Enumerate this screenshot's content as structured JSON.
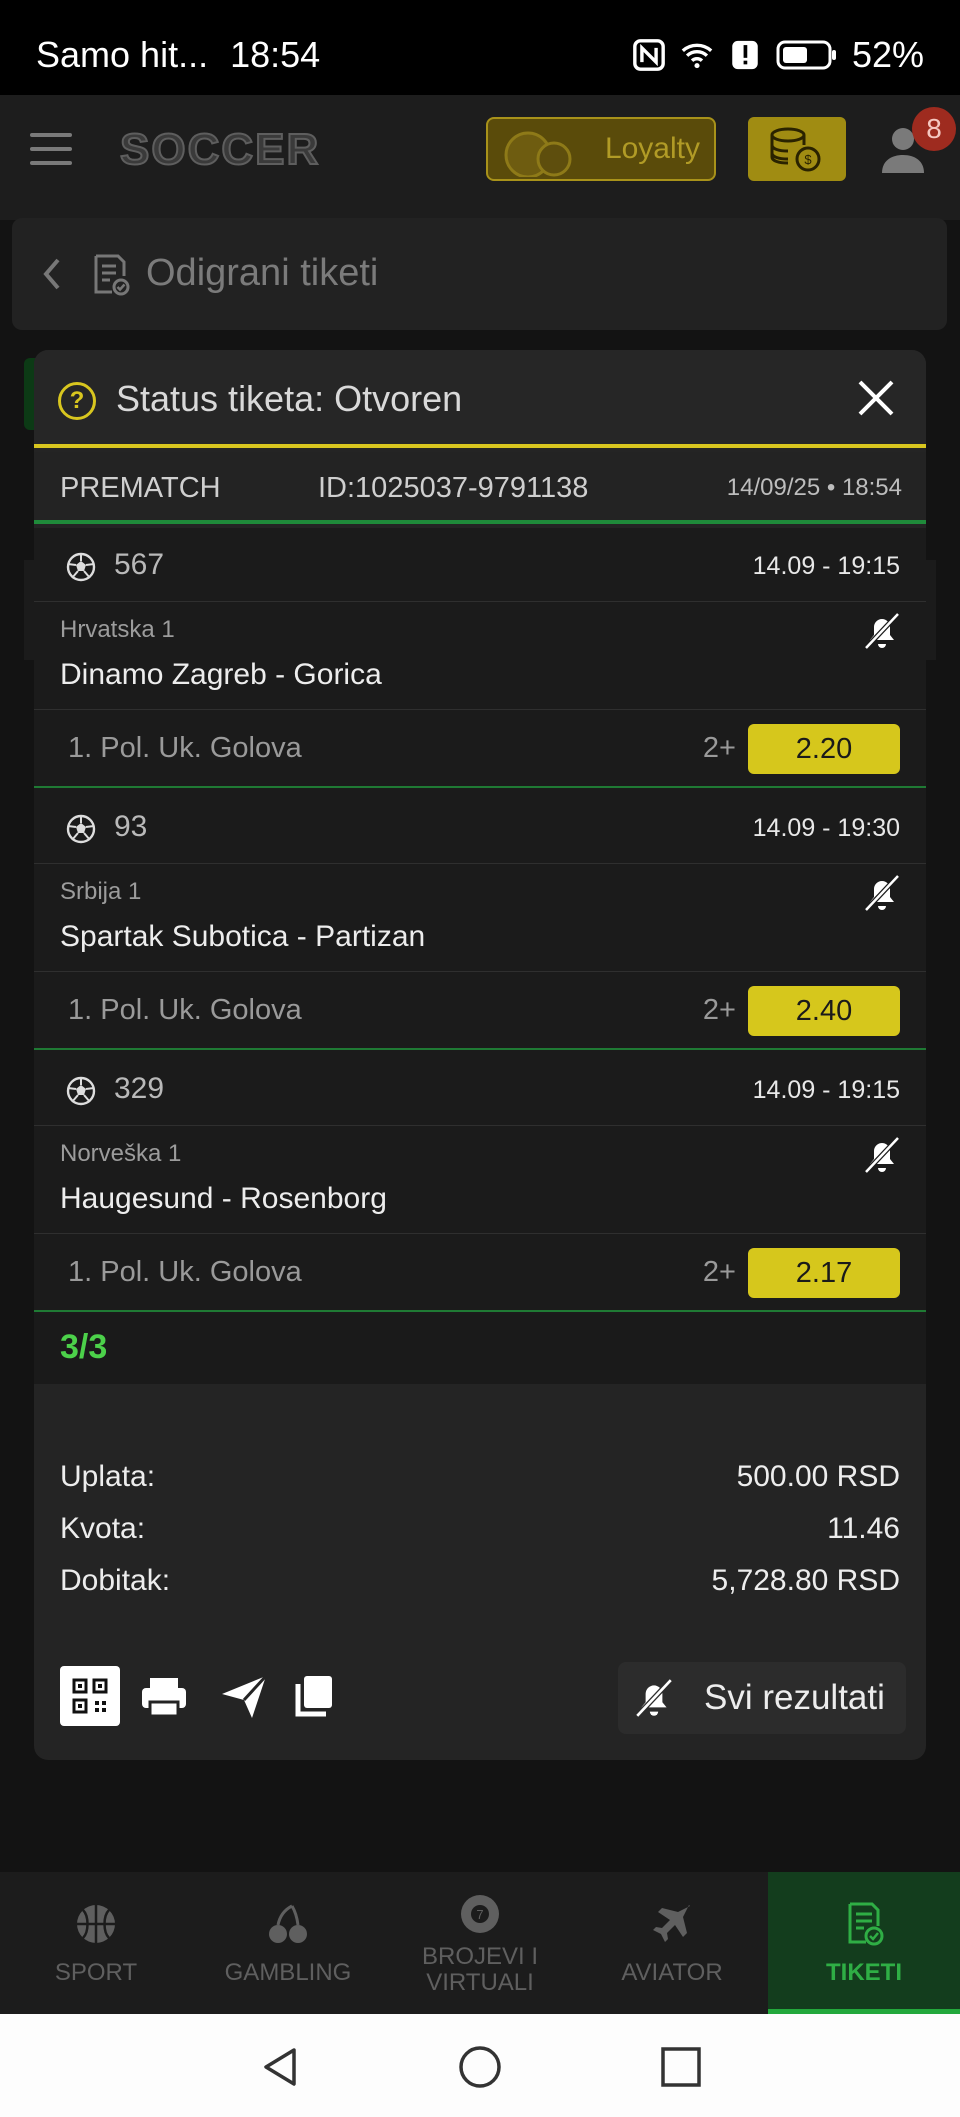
{
  "status_bar": {
    "carrier": "Samo hit...",
    "time": "18:54",
    "battery": "52%"
  },
  "header": {
    "logo": "SOCCER",
    "loyalty_label": "Loyalty",
    "notification_count": "8"
  },
  "page": {
    "title": "Odigrani tiketi"
  },
  "modal": {
    "title": "Status tiketa: Otvoren",
    "type": "PREMATCH",
    "ticket_id": "ID:1025037-9791138",
    "datetime": "14/09/25 • 18:54",
    "events": [
      {
        "code": "567",
        "time": "14.09  -  19:15",
        "league": "Hrvatska 1",
        "match": "Dinamo Zagreb - Gorica",
        "market": "1. Pol. Uk. Golova",
        "pick": "2+",
        "odd": "2.20"
      },
      {
        "code": "93",
        "time": "14.09  -  19:30",
        "league": "Srbija 1",
        "match": "Spartak Subotica - Partizan",
        "market": "1. Pol. Uk. Golova",
        "pick": "2+",
        "odd": "2.40"
      },
      {
        "code": "329",
        "time": "14.09  -  19:15",
        "league": "Norveška 1",
        "match": "Haugesund - Rosenborg",
        "market": "1. Pol. Uk. Golova",
        "pick": "2+",
        "odd": "2.17"
      }
    ],
    "count": "3/3",
    "summary": {
      "stake_label": "Uplata:",
      "stake_value": "500.00 RSD",
      "odds_label": "Kvota:",
      "odds_value": "11.46",
      "win_label": "Dobitak:",
      "win_value": "5,728.80 RSD"
    },
    "all_results_label": "Svi rezultati"
  },
  "bottom_nav": [
    {
      "label": "SPORT",
      "icon": "basketball-icon"
    },
    {
      "label": "GAMBLING",
      "icon": "cherries-icon"
    },
    {
      "label": "BROJEVI I VIRTUALI",
      "icon": "lottery-ball-icon"
    },
    {
      "label": "AVIATOR",
      "icon": "airplane-icon"
    },
    {
      "label": "TIKETI",
      "icon": "ticket-icon"
    }
  ],
  "colors": {
    "accent_yellow": "#d6c71c",
    "accent_green": "#23a83c",
    "count_green": "#4cd14a"
  }
}
